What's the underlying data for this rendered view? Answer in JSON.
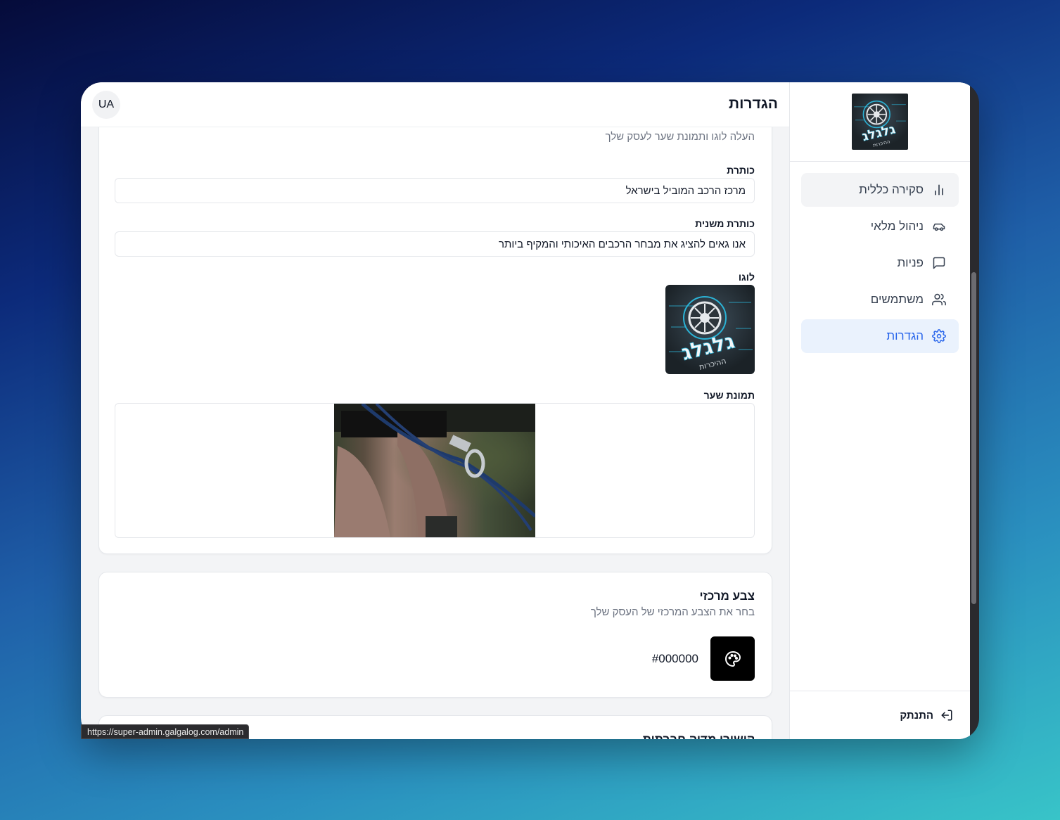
{
  "header": {
    "title": "הגדרות",
    "avatar_initials": "UA"
  },
  "sidebar": {
    "items": [
      {
        "label": "סקירה כללית",
        "icon": "bar-chart-icon",
        "state": "hover"
      },
      {
        "label": "ניהול מלאי",
        "icon": "car-icon",
        "state": "default"
      },
      {
        "label": "פניות",
        "icon": "message-square-icon",
        "state": "default"
      },
      {
        "label": "משתמשים",
        "icon": "users-icon",
        "state": "default"
      },
      {
        "label": "הגדרות",
        "icon": "settings-icon",
        "state": "active"
      }
    ],
    "logout_label": "התנתק"
  },
  "branding_card": {
    "description": "העלה לוגו ותמונת שער לעסק שלך",
    "title_label": "כותרת",
    "title_value": "מרכז הרכב המוביל בישראל",
    "subtitle_label": "כותרת משנית",
    "subtitle_value": "אנו גאים להציג את מבחר הרכבים האיכותי והמקיף ביותר",
    "logo_label": "לוגו",
    "cover_label": "תמונת שער"
  },
  "color_card": {
    "title": "צבע מרכזי",
    "description": "בחר את הצבע המרכזי של העסק שלך",
    "color_value": "#000000"
  },
  "social_card": {
    "title": "קישורי מדיה חברתית"
  },
  "status_bar": {
    "url": "https://super-admin.galgalog.com/admin"
  },
  "colors": {
    "accent": "#2563eb",
    "active_bg": "#eaf2fd",
    "primary_color": "#000000"
  }
}
